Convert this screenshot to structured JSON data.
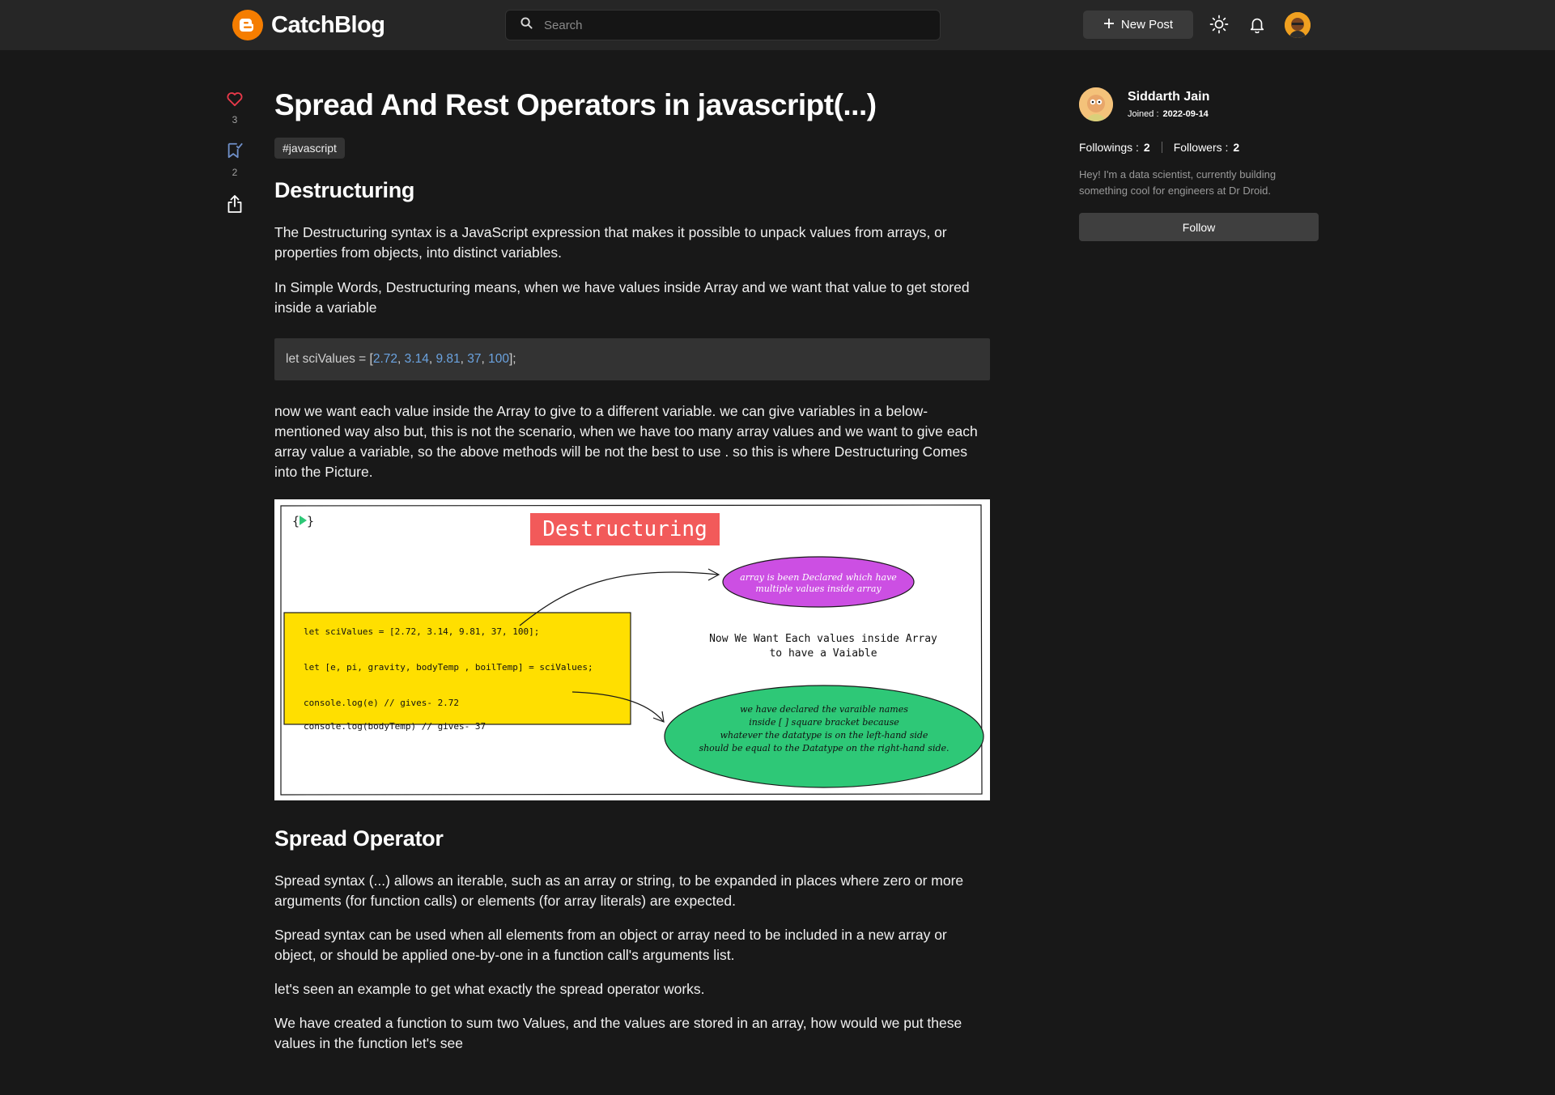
{
  "brand": {
    "name": "CatchBlog",
    "logo_letter": "B",
    "accent": "#f57d00"
  },
  "search": {
    "placeholder": "Search",
    "value": ""
  },
  "nav": {
    "new_post_label": "New Post",
    "icons": [
      "theme-toggle-icon",
      "bell-icon",
      "user-avatar"
    ]
  },
  "reactions": {
    "likes": "3",
    "bookmarks": "2"
  },
  "article": {
    "title": "Spread And Rest Operators in javascript(...)",
    "tag": "javascript",
    "section1_heading": "Destructuring",
    "p1": "The Destructuring syntax is a JavaScript expression that makes it possible to unpack values from arrays, or properties from objects, into distinct variables.",
    "p2": "In Simple Words, Destructuring means, when we have values inside Array and we want that value to get stored inside a variable",
    "code": {
      "prefix": "let sciValues = [",
      "nums": [
        "2.72",
        "3.14",
        "9.81",
        "37",
        "100"
      ],
      "suffix": "];"
    },
    "p3": "now we want each value inside the Array to give to a different variable. we can give variables in a below-mentioned way also but, this is not the scenario, when we have too many array values and we want to give each array value a variable, so the above methods will be not the best to use . so this is where Destructuring Comes into the Picture.",
    "diagram": {
      "title": "Destructuring",
      "code_lines": [
        "let sciValues = [2.72, 3.14, 9.81, 37, 100];",
        "let [e, pi, gravity, bodyTemp , boilTemp] = sciValues;",
        "console.log(e) // gives- 2.72",
        "console.log(bodyTemp) // gives- 37"
      ],
      "purple_note": [
        "array is been Declared which have",
        "multiple values inside array"
      ],
      "middle_note": [
        "Now We Want Each values inside Array",
        "to have a Vaiable"
      ],
      "green_note": [
        "we have declared the varaible names",
        "inside [ ] square bracket because",
        "whatever the datatype is on the left-hand side",
        "should be equal to the Datatype on the right-hand side."
      ],
      "colors": {
        "title_bg": "#f25a5a",
        "code_box": "#ffdf00",
        "purple": "#cc4fe3",
        "green": "#2ec877"
      }
    },
    "section2_heading": "Spread Operator",
    "p4": "Spread syntax (...) allows an iterable, such as an array or string, to be expanded in places where zero or more arguments (for function calls) or elements (for array literals) are expected.",
    "p5": "Spread syntax can be used when all elements from an object or array need to be included in a new array or object, or should be applied one-by-one in a function call's arguments list.",
    "p6": "let's seen an example to get what exactly the spread operator works.",
    "p7": "We have created a function to sum two Values, and the values are stored in an array, how would we put these values in the function let's see"
  },
  "author": {
    "name": "Siddarth Jain",
    "joined_label": "Joined :",
    "joined_date": "2022-09-14",
    "followings_label": "Followings :",
    "followings": "2",
    "followers_label": "Followers :",
    "followers": "2",
    "bio": "Hey! I'm a data scientist, currently building something cool for engineers at Dr Droid.",
    "follow_label": "Follow"
  }
}
